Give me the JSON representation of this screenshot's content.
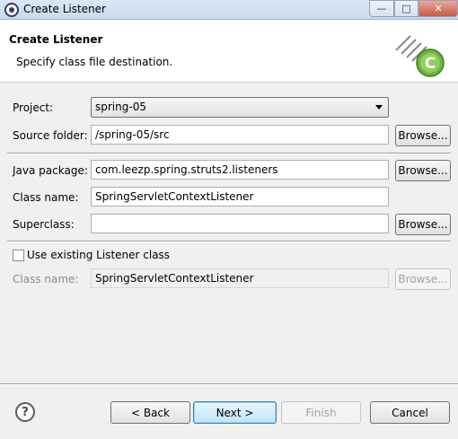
{
  "window": {
    "title": "Create Listener",
    "minimize": "—",
    "maximize": "□",
    "close": "✕"
  },
  "banner": {
    "title": "Create Listener",
    "description": "Specify class file destination.",
    "graphic_letter": "C"
  },
  "form": {
    "project_label": "Project:",
    "project_value": "spring-05",
    "source_folder_label": "Source folder:",
    "source_folder_value": "/spring-05/src",
    "java_package_label": "Java package:",
    "java_package_value": "com.leezp.spring.struts2.listeners",
    "class_name_label": "Class name:",
    "class_name_value": "SpringServletContextListener",
    "superclass_label": "Superclass:",
    "superclass_value": "",
    "use_existing_label": "Use existing Listener class",
    "use_existing_checked": false,
    "existing_class_label": "Class name:",
    "existing_class_value": "SpringServletContextListener",
    "browse_label": "Browse..."
  },
  "footer": {
    "help_glyph": "?",
    "back_label": "< Back",
    "next_label": "Next >",
    "finish_label": "Finish",
    "cancel_label": "Cancel"
  },
  "colors": {
    "banner_bg": "#ffffff",
    "dialog_bg": "#f0f0f0",
    "eclipse_green": "#6db33f"
  }
}
